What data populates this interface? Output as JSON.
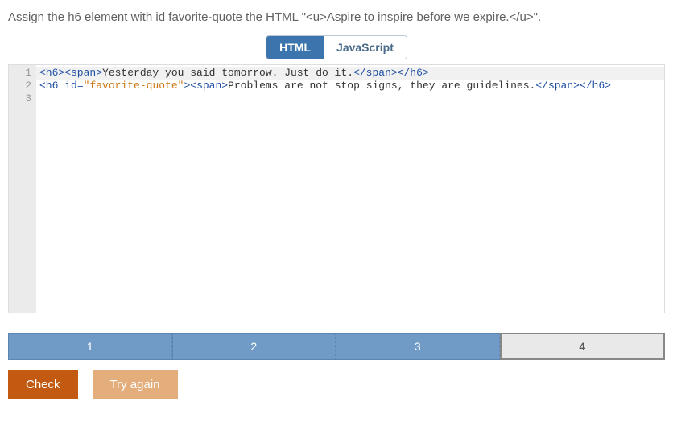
{
  "instructions": "Assign the h6 element with id favorite-quote the HTML \"<u>Aspire to inspire before we expire.</u>\".",
  "tabs": {
    "html": "HTML",
    "js": "JavaScript",
    "active": "html"
  },
  "editor": {
    "line_numbers": [
      "1",
      "2",
      "3"
    ],
    "lines": [
      {
        "highlight": true,
        "tokens": [
          {
            "c": "tag",
            "t": "<h6><span>"
          },
          {
            "c": "text",
            "t": "Yesterday you said tomorrow. Just do it."
          },
          {
            "c": "tag",
            "t": "</span></h6>"
          }
        ]
      },
      {
        "highlight": false,
        "tokens": [
          {
            "c": "tag",
            "t": "<h6 "
          },
          {
            "c": "attr",
            "t": "id"
          },
          {
            "c": "tag",
            "t": "="
          },
          {
            "c": "val",
            "t": "\"favorite-quote\""
          },
          {
            "c": "tag",
            "t": "><span>"
          },
          {
            "c": "text",
            "t": "Problems are not stop signs, they are guidelines."
          },
          {
            "c": "tag",
            "t": "</span></h6>"
          }
        ]
      },
      {
        "highlight": false,
        "tokens": []
      }
    ]
  },
  "steps": [
    "1",
    "2",
    "3",
    "4"
  ],
  "current_step": 4,
  "buttons": {
    "check": "Check",
    "try_again": "Try again"
  }
}
